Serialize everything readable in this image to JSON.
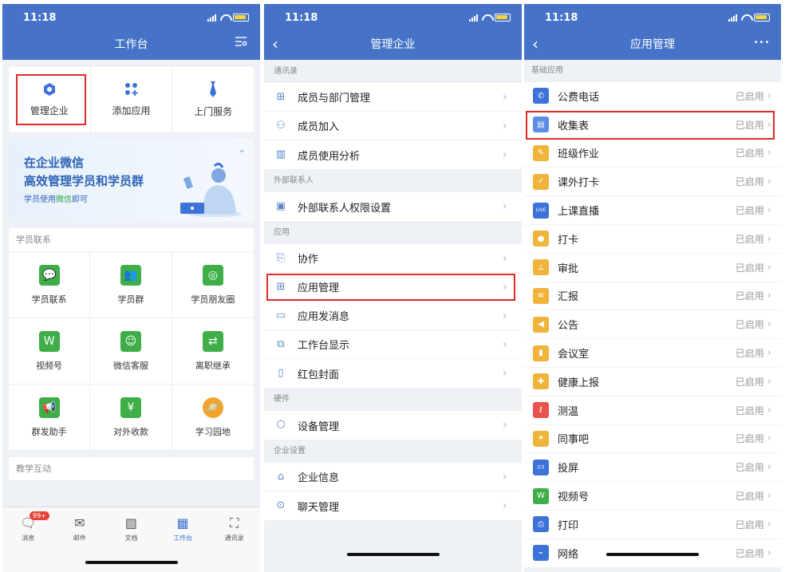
{
  "status": {
    "time": "11:18"
  },
  "screen1": {
    "title": "工作台",
    "top_actions": [
      {
        "label": "管理企业",
        "icon": "hexagon-icon",
        "color": "#3d72d9"
      },
      {
        "label": "添加应用",
        "icon": "add-apps-icon",
        "color": "#3d72d9"
      },
      {
        "label": "上门服务",
        "icon": "tie-icon",
        "color": "#3d72d9"
      }
    ],
    "banner": {
      "line1": "在企业微信",
      "line2": "高效管理学员和学员群",
      "sub_prefix": "学员使用",
      "sub_highlight": "微信",
      "sub_suffix": "即可"
    },
    "section_student": {
      "title": "学员联系",
      "items": [
        {
          "label": "学员联系",
          "icon": "chat-bubble-icon",
          "color": "#3fae48"
        },
        {
          "label": "学员群",
          "icon": "group-icon",
          "color": "#3fae48"
        },
        {
          "label": "学员朋友圈",
          "icon": "moments-icon",
          "color": "#3fae48"
        },
        {
          "label": "视频号",
          "icon": "channels-icon",
          "color": "#3fae48"
        },
        {
          "label": "微信客服",
          "icon": "service-chat-icon",
          "color": "#3fae48"
        },
        {
          "label": "离职继承",
          "icon": "transfer-icon",
          "color": "#3fae48"
        },
        {
          "label": "群发助手",
          "icon": "megaphone-icon",
          "color": "#3fae48"
        },
        {
          "label": "对外收款",
          "icon": "yuan-icon",
          "color": "#3fae48"
        },
        {
          "label": "学习园地",
          "icon": "planet-icon",
          "color": "#efa52f"
        }
      ]
    },
    "section_teaching": {
      "title": "教学互动"
    },
    "tabs": [
      {
        "label": "消息",
        "icon": "message-icon",
        "badge": "99+"
      },
      {
        "label": "邮件",
        "icon": "mail-icon"
      },
      {
        "label": "文档",
        "icon": "doc-icon"
      },
      {
        "label": "工作台",
        "icon": "workbench-icon",
        "active": true
      },
      {
        "label": "通讯录",
        "icon": "contacts-icon"
      }
    ]
  },
  "screen2": {
    "title": "管理企业",
    "groups": [
      {
        "title": "通讯录",
        "items": [
          {
            "label": "成员与部门管理",
            "icon": "org-chart-icon"
          },
          {
            "label": "成员加入",
            "icon": "add-member-icon"
          },
          {
            "label": "成员使用分析",
            "icon": "bar-chart-icon"
          }
        ]
      },
      {
        "title": "外部联系人",
        "items": [
          {
            "label": "外部联系人权限设置",
            "icon": "contact-card-icon"
          }
        ]
      },
      {
        "title": "应用",
        "items": [
          {
            "label": "协作",
            "icon": "collab-icon"
          },
          {
            "label": "应用管理",
            "icon": "app-grid-icon"
          },
          {
            "label": "应用发消息",
            "icon": "app-message-icon"
          },
          {
            "label": "工作台显示",
            "icon": "display-icon"
          },
          {
            "label": "红包封面",
            "icon": "envelope-cover-icon"
          }
        ]
      },
      {
        "title": "硬件",
        "items": [
          {
            "label": "设备管理",
            "icon": "device-cube-icon"
          }
        ]
      },
      {
        "title": "企业设置",
        "items": [
          {
            "label": "企业信息",
            "icon": "home-icon"
          },
          {
            "label": "聊天管理",
            "icon": "chat-manage-icon"
          }
        ]
      }
    ]
  },
  "screen3": {
    "title": "应用管理",
    "more": "•••",
    "section_title": "基础应用",
    "apps": [
      {
        "label": "公费电话",
        "icon": "phone-icon",
        "color": "#3d72d9",
        "status": "已启用"
      },
      {
        "label": "收集表",
        "icon": "form-icon",
        "color": "#5b8de6",
        "status": "已启用"
      },
      {
        "label": "班级作业",
        "icon": "homework-icon",
        "color": "#efb43c",
        "status": "已启用"
      },
      {
        "label": "课外打卡",
        "icon": "checkin-card-icon",
        "color": "#efb43c",
        "status": "已启用"
      },
      {
        "label": "上课直播",
        "icon": "live-icon",
        "color": "#3d72d9",
        "status": "已启用"
      },
      {
        "label": "打卡",
        "icon": "location-pin-icon",
        "color": "#efb43c",
        "status": "已启用"
      },
      {
        "label": "审批",
        "icon": "stamp-icon",
        "color": "#efb43c",
        "status": "已启用"
      },
      {
        "label": "汇报",
        "icon": "report-icon",
        "color": "#efb43c",
        "status": "已启用"
      },
      {
        "label": "公告",
        "icon": "announce-icon",
        "color": "#efb43c",
        "status": "已启用"
      },
      {
        "label": "会议室",
        "icon": "door-icon",
        "color": "#efb43c",
        "status": "已启用"
      },
      {
        "label": "健康上报",
        "icon": "health-icon",
        "color": "#efb43c",
        "status": "已启用"
      },
      {
        "label": "测温",
        "icon": "thermometer-icon",
        "color": "#e8524a",
        "status": "已启用"
      },
      {
        "label": "同事吧",
        "icon": "colleague-icon",
        "color": "#efb43c",
        "status": "已启用"
      },
      {
        "label": "投屏",
        "icon": "cast-icon",
        "color": "#3d72d9",
        "status": "已启用"
      },
      {
        "label": "视频号",
        "icon": "channels-icon",
        "color": "#3fae48",
        "status": "已启用"
      },
      {
        "label": "打印",
        "icon": "printer-icon",
        "color": "#3d72d9",
        "status": "已启用"
      },
      {
        "label": "网络",
        "icon": "network-icon",
        "color": "#3d72d9",
        "status": "已启用"
      }
    ]
  },
  "ui": {
    "chevron": "›",
    "back": "‹"
  }
}
